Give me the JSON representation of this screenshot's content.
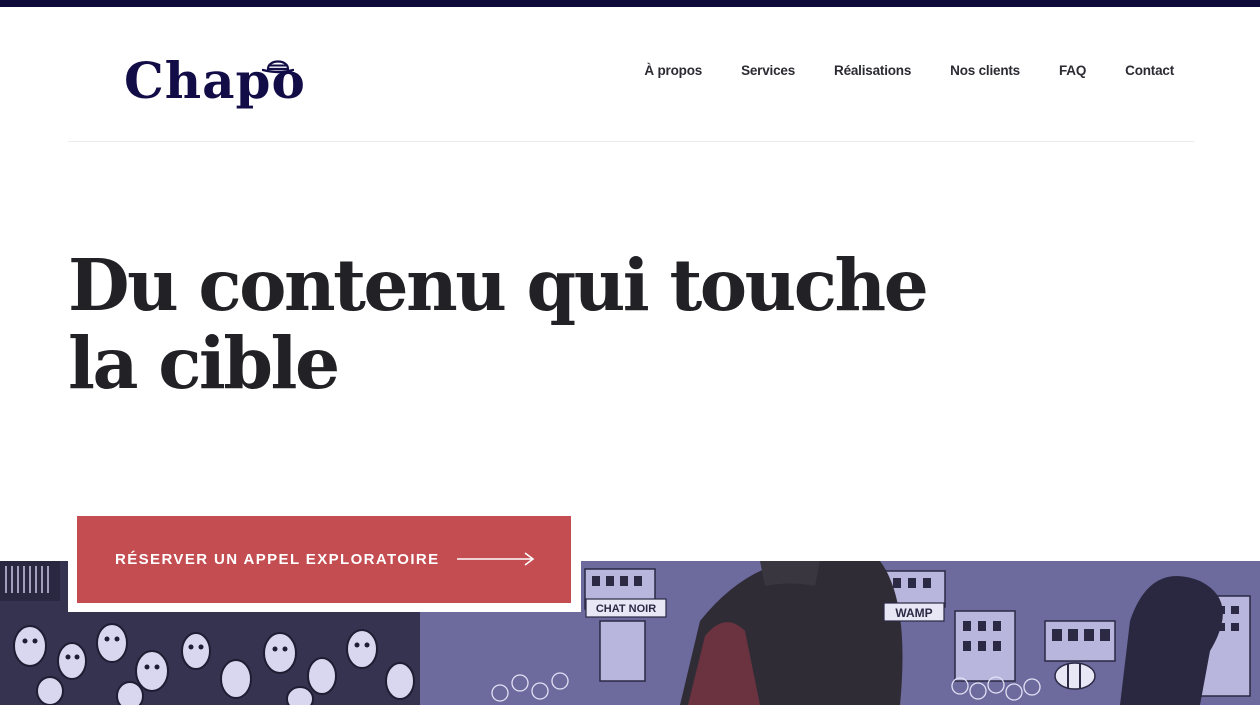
{
  "brand": {
    "name": "Chapo"
  },
  "nav": {
    "items": [
      {
        "label": "À propos"
      },
      {
        "label": "Services"
      },
      {
        "label": "Réalisations"
      },
      {
        "label": "Nos clients"
      },
      {
        "label": "FAQ"
      },
      {
        "label": "Contact"
      }
    ]
  },
  "hero": {
    "title": "Du contenu qui touche la cible",
    "cta_label": "RÉSERVER UN APPEL EXPLORATOIRE"
  },
  "banner": {
    "sign_1": "CHAT NOIR",
    "sign_2": "WAMP"
  },
  "colors": {
    "stripe": "#0e0a3a",
    "brand": "#120c47",
    "cta": "#c44d52",
    "banner_tint": "#6c6a9c"
  },
  "icons": {
    "logo_hat": "bowler-hat-icon",
    "cta_arrow": "long-arrow-right-icon"
  }
}
